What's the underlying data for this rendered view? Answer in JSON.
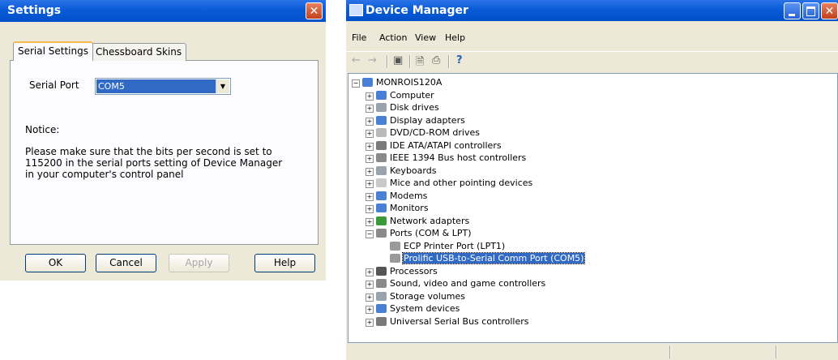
{
  "settings_dialog": {
    "title": "Settings",
    "close_label": "✕",
    "tabs": [
      {
        "label": "Serial Settings",
        "active": true
      },
      {
        "label": "Chessboard Skins",
        "active": false
      }
    ],
    "serial_port": {
      "label": "Serial Port",
      "value": "COM5",
      "arrow": "▼"
    },
    "notice": {
      "title": "Notice:",
      "text": "Please make sure that the bits per second is set to 115200 in the serial ports setting of Device Manager in your computer's control panel"
    },
    "buttons": {
      "ok": "OK",
      "cancel": "Cancel",
      "apply": "Apply",
      "help": "Help"
    }
  },
  "device_manager": {
    "title": "Device Manager",
    "close_label": "✕",
    "menu": {
      "file": "File",
      "action": "Action",
      "view": "View",
      "help": "Help"
    },
    "toolbar": {
      "back": "←",
      "forward": "→",
      "show_hide": "▣",
      "properties": "🗎",
      "print": "⎙",
      "help": "?"
    },
    "tree": {
      "root": "MONROIS120A",
      "categories": [
        {
          "label": "Computer",
          "icon": "computer-icon",
          "color": "#4a7fd6"
        },
        {
          "label": "Disk drives",
          "icon": "disk-drive-icon",
          "color": "#9aa3ad"
        },
        {
          "label": "Display adapters",
          "icon": "display-adapter-icon",
          "color": "#4a7fd6"
        },
        {
          "label": "DVD/CD-ROM drives",
          "icon": "dvd-drive-icon",
          "color": "#b9b9b9"
        },
        {
          "label": "IDE ATA/ATAPI controllers",
          "icon": "ide-controller-icon",
          "color": "#7a7a7a"
        },
        {
          "label": "IEEE 1394 Bus host controllers",
          "icon": "ieee1394-icon",
          "color": "#8a8a8a"
        },
        {
          "label": "Keyboards",
          "icon": "keyboard-icon",
          "color": "#9aa3ad"
        },
        {
          "label": "Mice and other pointing devices",
          "icon": "mouse-icon",
          "color": "#c9c9c9"
        },
        {
          "label": "Modems",
          "icon": "modem-icon",
          "color": "#4a7fd6"
        },
        {
          "label": "Monitors",
          "icon": "monitor-icon",
          "color": "#4a7fd6"
        },
        {
          "label": "Network adapters",
          "icon": "network-adapter-icon",
          "color": "#3a9a3a"
        },
        {
          "label": "Ports (COM & LPT)",
          "icon": "port-icon",
          "color": "#8a8a8a",
          "expanded": true,
          "children": [
            {
              "label": "ECP Printer Port (LPT1)",
              "icon": "port-icon"
            },
            {
              "label": "Prolific USB-to-Serial Comm Port (COM5)",
              "icon": "port-icon",
              "selected": true
            }
          ]
        },
        {
          "label": "Processors",
          "icon": "processor-icon",
          "color": "#555555"
        },
        {
          "label": "Sound, video and game controllers",
          "icon": "sound-icon",
          "color": "#8a8a8a"
        },
        {
          "label": "Storage volumes",
          "icon": "storage-volume-icon",
          "color": "#9aa3ad"
        },
        {
          "label": "System devices",
          "icon": "system-device-icon",
          "color": "#4a7fd6"
        },
        {
          "label": "Universal Serial Bus controllers",
          "icon": "usb-icon",
          "color": "#7a7a7a"
        }
      ]
    }
  }
}
